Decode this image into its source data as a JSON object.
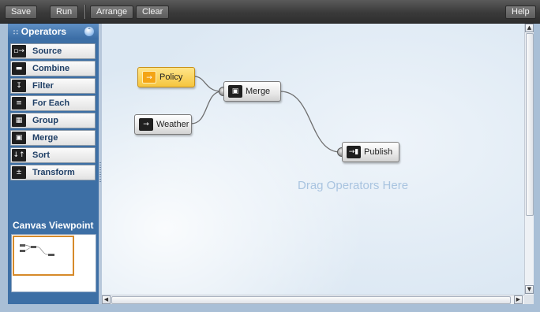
{
  "toolbar": {
    "save_label": "Save",
    "run_label": "Run",
    "arrange_label": "Arrange",
    "clear_label": "Clear",
    "help_label": "Help"
  },
  "palette": {
    "title": "Operators",
    "operators": [
      {
        "label": "Source",
        "icon": "source-icon"
      },
      {
        "label": "Combine",
        "icon": "combine-icon"
      },
      {
        "label": "Filter",
        "icon": "filter-icon"
      },
      {
        "label": "For Each",
        "icon": "for-each-icon"
      },
      {
        "label": "Group",
        "icon": "group-icon"
      },
      {
        "label": "Merge",
        "icon": "merge-icon"
      },
      {
        "label": "Sort",
        "icon": "sort-icon"
      },
      {
        "label": "Transform",
        "icon": "transform-icon"
      }
    ],
    "viewport_title": "Canvas Viewpoint"
  },
  "canvas": {
    "hint": "Drag Operators Here",
    "nodes": [
      {
        "label": "Policy",
        "icon": "source-icon",
        "selected": true
      },
      {
        "label": "Weather",
        "icon": "source-icon",
        "selected": false
      },
      {
        "label": "Merge",
        "icon": "merge-icon",
        "selected": false
      },
      {
        "label": "Publish",
        "icon": "publish-icon",
        "selected": false
      }
    ]
  },
  "colors": {
    "toolbar_bg": "#3a3a3a",
    "palette_bg": "#3d6fa5",
    "selected_node": "#f5c53e",
    "minimap_frame": "#d68a2a",
    "hint_text": "#a9c4e0"
  }
}
